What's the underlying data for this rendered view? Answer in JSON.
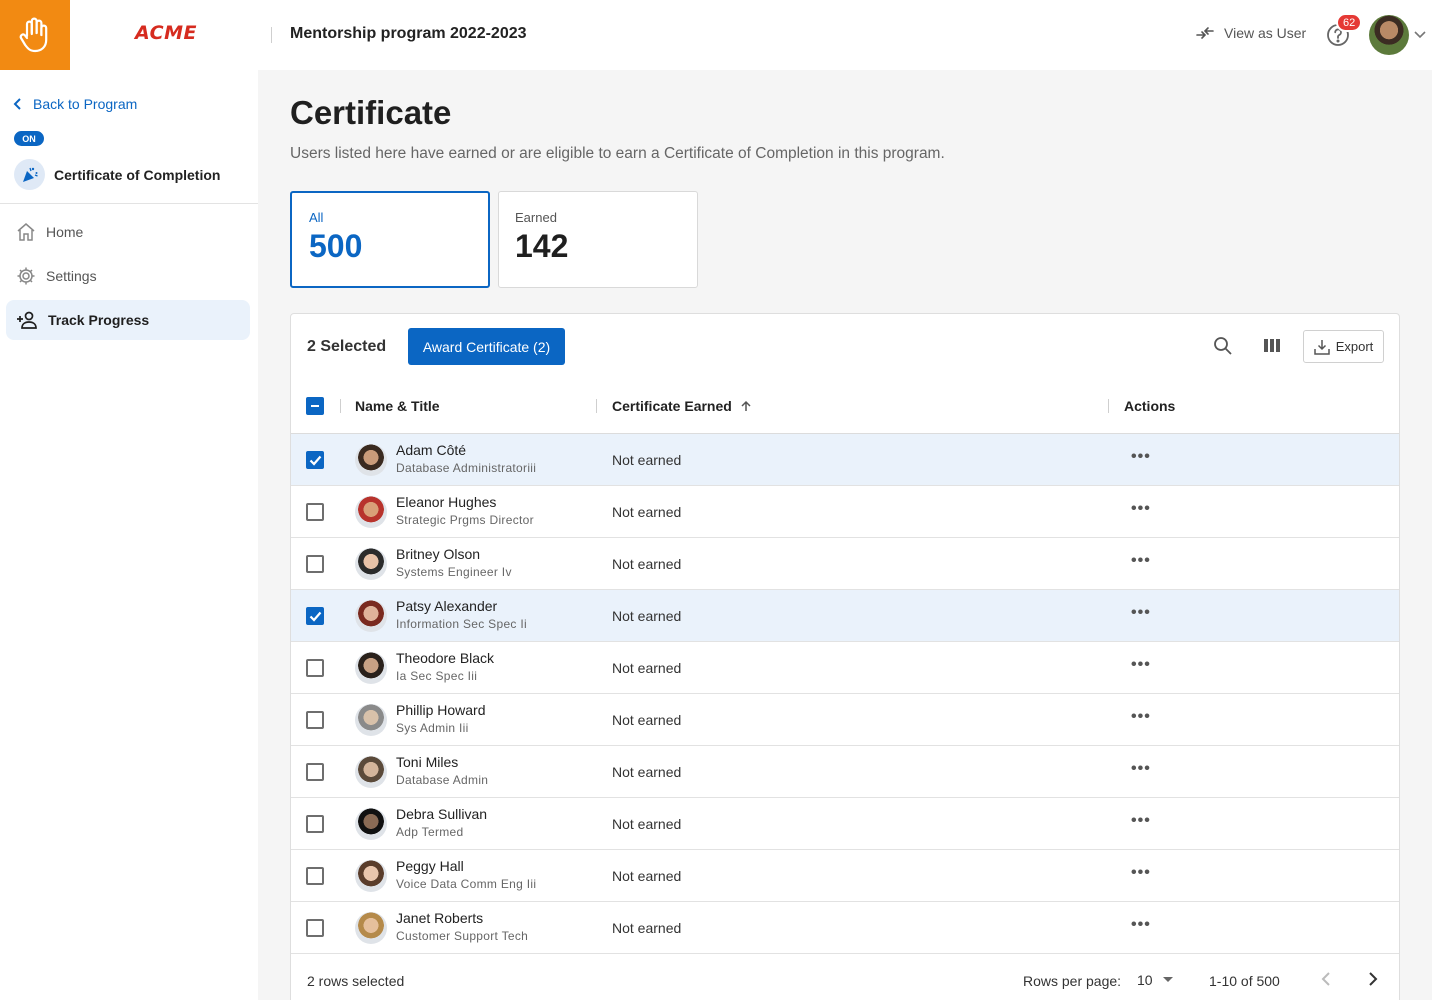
{
  "header": {
    "brand": "ACME",
    "program_title": "Mentorship program 2022-2023",
    "view_as_user": "View as User",
    "notification_count": "62"
  },
  "sidebar": {
    "back_label": "Back to Program",
    "status_pill": "ON",
    "certificate_name": "Certificate of Completion",
    "items": [
      {
        "label": "Home",
        "icon": "home-icon"
      },
      {
        "label": "Settings",
        "icon": "gear-icon"
      },
      {
        "label": "Track Progress",
        "icon": "add-person-icon",
        "active": true
      }
    ]
  },
  "main": {
    "title": "Certificate",
    "subtitle": "Users listed here have earned or are eligible to earn a Certificate of Completion in this program.",
    "stats": [
      {
        "label": "All",
        "value": "500",
        "active": true
      },
      {
        "label": "Earned",
        "value": "142",
        "active": false
      }
    ]
  },
  "table": {
    "selected_text": "2 Selected",
    "award_button": "Award Certificate (2)",
    "export_label": "Export",
    "columns": [
      "Name & Title",
      "Certificate Earned",
      "Actions"
    ],
    "sort_column": "Certificate Earned",
    "rows": [
      {
        "name": "Adam Côté",
        "title": "Database Administratoriii",
        "status": "Not earned",
        "selected": true
      },
      {
        "name": "Eleanor Hughes",
        "title": "Strategic Prgms Director",
        "status": "Not earned",
        "selected": false
      },
      {
        "name": "Britney Olson",
        "title": "Systems Engineer Iv",
        "status": "Not earned",
        "selected": false
      },
      {
        "name": "Patsy Alexander",
        "title": "Information Sec Spec Ii",
        "status": "Not earned",
        "selected": true
      },
      {
        "name": "Theodore Black",
        "title": "Ia Sec Spec Iii",
        "status": "Not earned",
        "selected": false
      },
      {
        "name": "Phillip Howard",
        "title": "Sys Admin Iii",
        "status": "Not earned",
        "selected": false
      },
      {
        "name": "Toni Miles",
        "title": "Database Admin",
        "status": "Not earned",
        "selected": false
      },
      {
        "name": "Debra Sullivan",
        "title": "Adp Termed",
        "status": "Not earned",
        "selected": false
      },
      {
        "name": "Peggy Hall",
        "title": "Voice Data Comm Eng Iii",
        "status": "Not earned",
        "selected": false
      },
      {
        "name": "Janet Roberts",
        "title": "Customer Support Tech",
        "status": "Not earned",
        "selected": false
      }
    ],
    "footer": {
      "rows_selected": "2 rows selected",
      "rows_per_page_label": "Rows per page:",
      "rows_per_page_value": "10",
      "range": "1-10 of 500"
    }
  },
  "colors": {
    "primary": "#0b66c3",
    "brand_orange": "#f28a12",
    "badge_red": "#e53935"
  }
}
